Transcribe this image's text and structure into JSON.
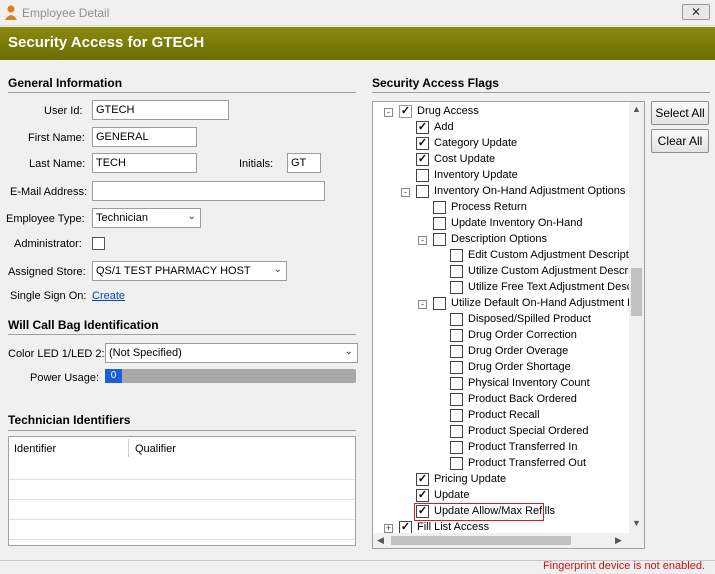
{
  "window": {
    "title": "Employee Detail",
    "close_label": "✕"
  },
  "header": {
    "title": "Security Access for GTECH"
  },
  "general": {
    "heading": "General Information",
    "user_id_label": "User Id:",
    "user_id": "GTECH",
    "first_name_label": "First Name:",
    "first_name": "GENERAL",
    "last_name_label": "Last Name:",
    "last_name": "TECH",
    "initials_label": "Initials:",
    "initials": "GT",
    "email_label": "E-Mail Address:",
    "email": "",
    "emp_type_label": "Employee Type:",
    "emp_type": "Technician",
    "admin_label": "Administrator:",
    "admin_checked": false,
    "store_label": "Assigned Store:",
    "store": "QS/1 TEST PHARMACY HOST",
    "sso_label": "Single Sign On:",
    "sso_link": "Create"
  },
  "willcall": {
    "heading": "Will Call Bag Identification",
    "led_label": "Color LED 1/LED 2:",
    "led_value": "(Not Specified)",
    "power_label": "Power Usage:",
    "power_value": "0"
  },
  "technician": {
    "heading": "Technician Identifiers",
    "columns": [
      "Identifier",
      "Qualifier"
    ]
  },
  "flags": {
    "heading": "Security Access Flags",
    "select_all": "Select All",
    "clear_all": "Clear All",
    "tree": [
      {
        "label": "Drug Access",
        "level": 0,
        "checked": true,
        "partial": true,
        "expander": "-"
      },
      {
        "label": "Add",
        "level": 1,
        "checked": true
      },
      {
        "label": "Category Update",
        "level": 1,
        "checked": true
      },
      {
        "label": "Cost Update",
        "level": 1,
        "checked": true
      },
      {
        "label": "Inventory Update",
        "level": 1,
        "checked": false
      },
      {
        "label": "Inventory On-Hand Adjustment Options",
        "level": 1,
        "checked": false,
        "expander": "-"
      },
      {
        "label": "Process Return",
        "level": 2,
        "checked": false
      },
      {
        "label": "Update Inventory On-Hand",
        "level": 2,
        "checked": false
      },
      {
        "label": "Description Options",
        "level": 2,
        "checked": false,
        "expander": "-"
      },
      {
        "label": "Edit Custom Adjustment Descriptio",
        "level": 3,
        "checked": false
      },
      {
        "label": "Utilize Custom Adjustment Descrip",
        "level": 3,
        "checked": false
      },
      {
        "label": "Utilize Free Text Adjustment Desc",
        "level": 3,
        "checked": false
      },
      {
        "label": "Utilize Default On-Hand Adjustment D",
        "level": 2,
        "checked": false,
        "expander": "-"
      },
      {
        "label": "Disposed/Spilled Product",
        "level": 3,
        "checked": false
      },
      {
        "label": "Drug Order Correction",
        "level": 3,
        "checked": false
      },
      {
        "label": "Drug Order Overage",
        "level": 3,
        "checked": false
      },
      {
        "label": "Drug Order Shortage",
        "level": 3,
        "checked": false
      },
      {
        "label": "Physical Inventory Count",
        "level": 3,
        "checked": false
      },
      {
        "label": "Product Back Ordered",
        "level": 3,
        "checked": false
      },
      {
        "label": "Product Recall",
        "level": 3,
        "checked": false
      },
      {
        "label": "Product Special Ordered",
        "level": 3,
        "checked": false
      },
      {
        "label": "Product Transferred In",
        "level": 3,
        "checked": false
      },
      {
        "label": "Product Transferred Out",
        "level": 3,
        "checked": false
      },
      {
        "label": "Pricing Update",
        "level": 1,
        "checked": true
      },
      {
        "label": "Update",
        "level": 1,
        "checked": true
      },
      {
        "label": "Update Allow/Max Refills",
        "level": 1,
        "checked": true,
        "highlight": true
      },
      {
        "label": "Fill List Access",
        "level": 0,
        "checked": true,
        "expander": "+"
      }
    ]
  },
  "footer": {
    "fingerprint_msg": "Fingerprint device is not enabled."
  },
  "colors": {
    "header": "#7a7a00",
    "highlight": "#d02020",
    "error": "#d01010",
    "power_bar": "#1a5fd6"
  }
}
